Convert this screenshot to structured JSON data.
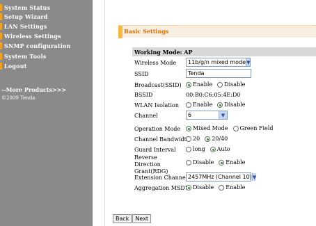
{
  "sidebar": {
    "items": [
      {
        "label": "System Status"
      },
      {
        "label": "Setup Wizard"
      },
      {
        "label": "LAN Settings"
      },
      {
        "label": "Wireless Settings"
      },
      {
        "label": "SNMP configuration"
      },
      {
        "label": "System Tools"
      },
      {
        "label": "Logout"
      }
    ],
    "more_products": "--More Products>>>",
    "copyright": "©2009 Tenda"
  },
  "page": {
    "section_title": "Basic Settings",
    "working_mode": "Working Mode: AP"
  },
  "form": {
    "wireless_mode": {
      "label": "Wireless Mode",
      "value": "11b/g/n mixed mode"
    },
    "ssid": {
      "label": "SSID",
      "value": "Tenda"
    },
    "broadcast": {
      "label": "Broadcast(SSID)",
      "options": [
        "Enable",
        "Disable"
      ],
      "selected": "Enable"
    },
    "bssid": {
      "label": "BSSID",
      "value": "00:B0:C6:05:4E:D0"
    },
    "wlan_isolation": {
      "label": "WLAN Isolation",
      "options": [
        "Enable",
        "Disable"
      ],
      "selected": "Disable"
    },
    "channel": {
      "label": "Channel",
      "value": "6"
    },
    "operation_mode": {
      "label": "Operation Mode",
      "options": [
        "Mixed Mode",
        "Green Field"
      ],
      "selected": "Mixed Mode"
    },
    "channel_bandwidth": {
      "label": "Channel Bandwidth",
      "options": [
        "20",
        "20/40"
      ],
      "selected": "20/40"
    },
    "guard_interval": {
      "label": "Guard Interval",
      "options": [
        "long",
        "Auto"
      ],
      "selected": "Auto"
    },
    "rdg": {
      "label": "Reverse Direction Grant(RDG)",
      "options": [
        "Disable",
        "Enable"
      ],
      "selected": "Enable"
    },
    "extension_channel": {
      "label": "Extension Channel",
      "value": "2457MHz (Channel 10)"
    },
    "aggregation_msdu": {
      "label": "Aggregation MSDU",
      "options": [
        "Disable",
        "Enable"
      ],
      "selected": "Disable"
    }
  },
  "buttons": {
    "back": "Back",
    "next": "Next"
  },
  "colors": {
    "sidebar_bg": "#8a8a8a",
    "accent": "#f3a11e",
    "section_title": "#e06f00",
    "radio_selected": "#2f8f2f"
  }
}
